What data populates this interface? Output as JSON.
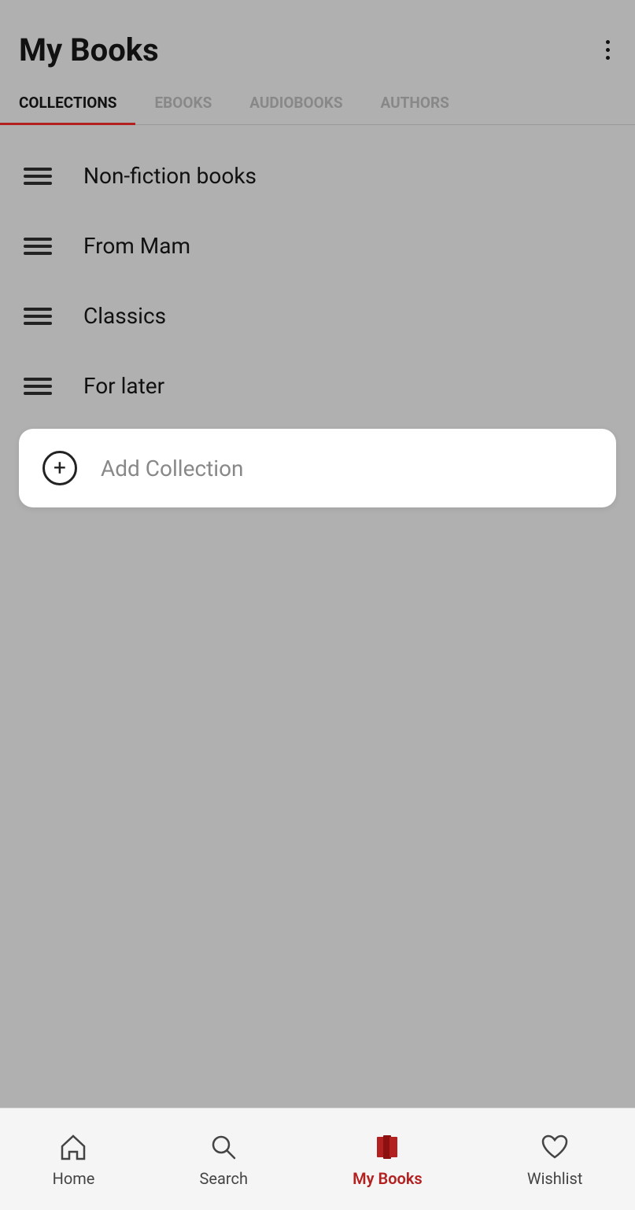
{
  "header": {
    "title": "My Books",
    "menu_icon_label": "more-options"
  },
  "tabs": [
    {
      "label": "COLLECTIONS",
      "active": true
    },
    {
      "label": "EBOOKS",
      "active": false
    },
    {
      "label": "AUDIOBOOKS",
      "active": false
    },
    {
      "label": "AUTHORS",
      "active": false
    }
  ],
  "collections": [
    {
      "name": "Non-fiction books"
    },
    {
      "name": "From Mam"
    },
    {
      "name": "Classics"
    },
    {
      "name": "For later"
    }
  ],
  "add_collection": {
    "label": "Add Collection"
  },
  "bottom_nav": [
    {
      "label": "Home",
      "active": false,
      "icon": "home-icon"
    },
    {
      "label": "Search",
      "active": false,
      "icon": "search-icon"
    },
    {
      "label": "My Books",
      "active": true,
      "icon": "mybooks-icon"
    },
    {
      "label": "Wishlist",
      "active": false,
      "icon": "wishlist-icon"
    }
  ],
  "colors": {
    "active_tab_underline": "#b22020",
    "active_nav_label": "#b22020",
    "background": "#b0b0b0"
  }
}
